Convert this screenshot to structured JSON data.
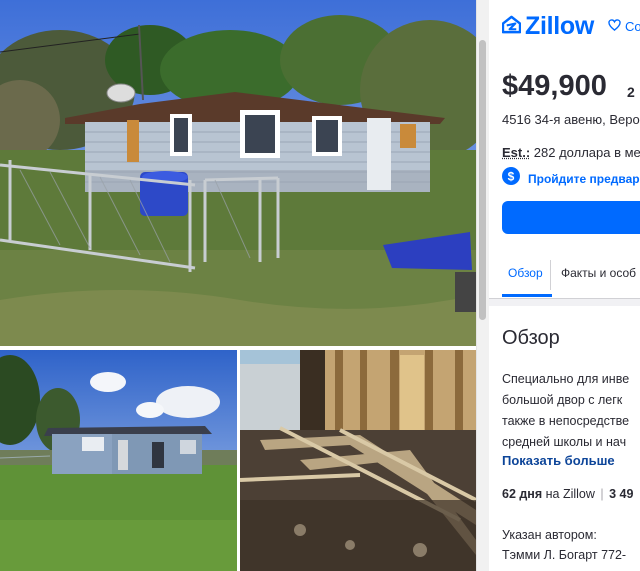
{
  "brand": {
    "name": "Zillow"
  },
  "header": {
    "save_label": "Co"
  },
  "listing": {
    "price": "$49,900",
    "beds": "2",
    "address": "4516 34-я авеню, Веро",
    "estimate_label": "Est.:",
    "estimate_value": " 282 доллара в ме",
    "prequalify_label": "Пройдите предвар"
  },
  "tabs": [
    {
      "label": "Обзор"
    },
    {
      "label": "Факты и особ"
    }
  ],
  "overview": {
    "heading": "Обзор",
    "lines": [
      "Специально для инве",
      "большой двор с легк",
      "также в непосредстве",
      "средней школы и нач"
    ],
    "show_more": "Показать больше"
  },
  "stats": {
    "days": "62 дня",
    "on_zillow": " на Zillow",
    "separator": "|",
    "views": " 3 49"
  },
  "listed_by": {
    "label": "Указан автором:",
    "agent": "Тэмми Л. Богарт 772-"
  },
  "photos": [
    {
      "name": "main-house-photo"
    },
    {
      "name": "house-rear-photo"
    },
    {
      "name": "interior-floor-photo"
    }
  ],
  "colors": {
    "accent": "#006aff",
    "text": "#2a2a33",
    "link_dark": "#0d4599"
  }
}
